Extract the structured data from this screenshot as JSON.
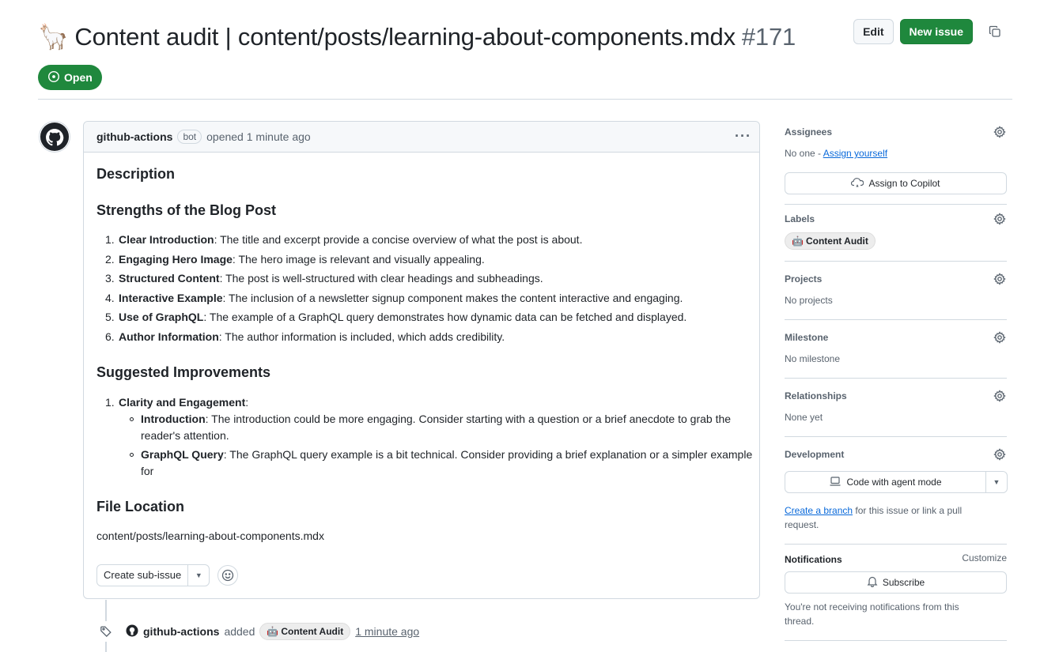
{
  "issue": {
    "emoji": "🦙",
    "title": "Content audit | content/posts/learning-about-components.mdx",
    "number": "#171",
    "state": "Open"
  },
  "header": {
    "edit_label": "Edit",
    "new_issue_label": "New issue"
  },
  "comment": {
    "author": "github-actions",
    "badge": "bot",
    "action": "opened 1 minute ago",
    "h_description": "Description",
    "h_strengths": "Strengths of the Blog Post",
    "strengths": [
      {
        "n": "1.",
        "bold": "Clear Introduction",
        "text": ": The title and excerpt provide a concise overview of what the post is about."
      },
      {
        "n": "2.",
        "bold": "Engaging Hero Image",
        "text": ": The hero image is relevant and visually appealing."
      },
      {
        "n": "3.",
        "bold": "Structured Content",
        "text": ": The post is well-structured with clear headings and subheadings."
      },
      {
        "n": "4.",
        "bold": "Interactive Example",
        "text": ": The inclusion of a newsletter signup component makes the content interactive and engaging."
      },
      {
        "n": "5.",
        "bold": "Use of GraphQL",
        "text": ": The example of a GraphQL query demonstrates how dynamic data can be fetched and displayed."
      },
      {
        "n": "6.",
        "bold": "Author Information",
        "text": ": The author information is included, which adds credibility."
      }
    ],
    "h_improvements": "Suggested Improvements",
    "improvement_1": {
      "n": "1.",
      "bold": "Clarity and Engagement",
      "text": ":"
    },
    "improvement_sub": [
      {
        "bold": "Introduction",
        "text": ": The introduction could be more engaging. Consider starting with a question or a brief anecdote to grab the reader's attention."
      },
      {
        "bold": "GraphQL Query",
        "text": ": The GraphQL query example is a bit technical. Consider providing a brief explanation or a simpler example for"
      }
    ],
    "h_file": "File Location",
    "file_path": "content/posts/learning-about-components.mdx",
    "create_subissue_label": "Create sub-issue"
  },
  "timeline": {
    "author": "github-actions",
    "action": "added",
    "label": "Content Audit",
    "label_emoji": "🤖",
    "time": "1 minute ago"
  },
  "sidebar": {
    "assignees_title": "Assignees",
    "assignees_value": "No one - ",
    "assign_yourself": "Assign yourself",
    "assign_copilot": "Assign to Copilot",
    "labels_title": "Labels",
    "label": "Content Audit",
    "label_emoji": "🤖",
    "projects_title": "Projects",
    "projects_value": "No projects",
    "milestone_title": "Milestone",
    "milestone_value": "No milestone",
    "relationships_title": "Relationships",
    "relationships_value": "None yet",
    "development_title": "Development",
    "agent_mode": "Code with agent mode",
    "create_branch": "Create a branch",
    "branch_rest": " for this issue or link a pull request.",
    "notifications_title": "Notifications",
    "customize": "Customize",
    "subscribe": "Subscribe",
    "notif_text": "You're not receiving notifications from this thread."
  },
  "colors": {
    "accent_green": "#1f883d",
    "link_blue": "#0969da",
    "muted": "#59636e",
    "border": "#d1d9e0"
  }
}
